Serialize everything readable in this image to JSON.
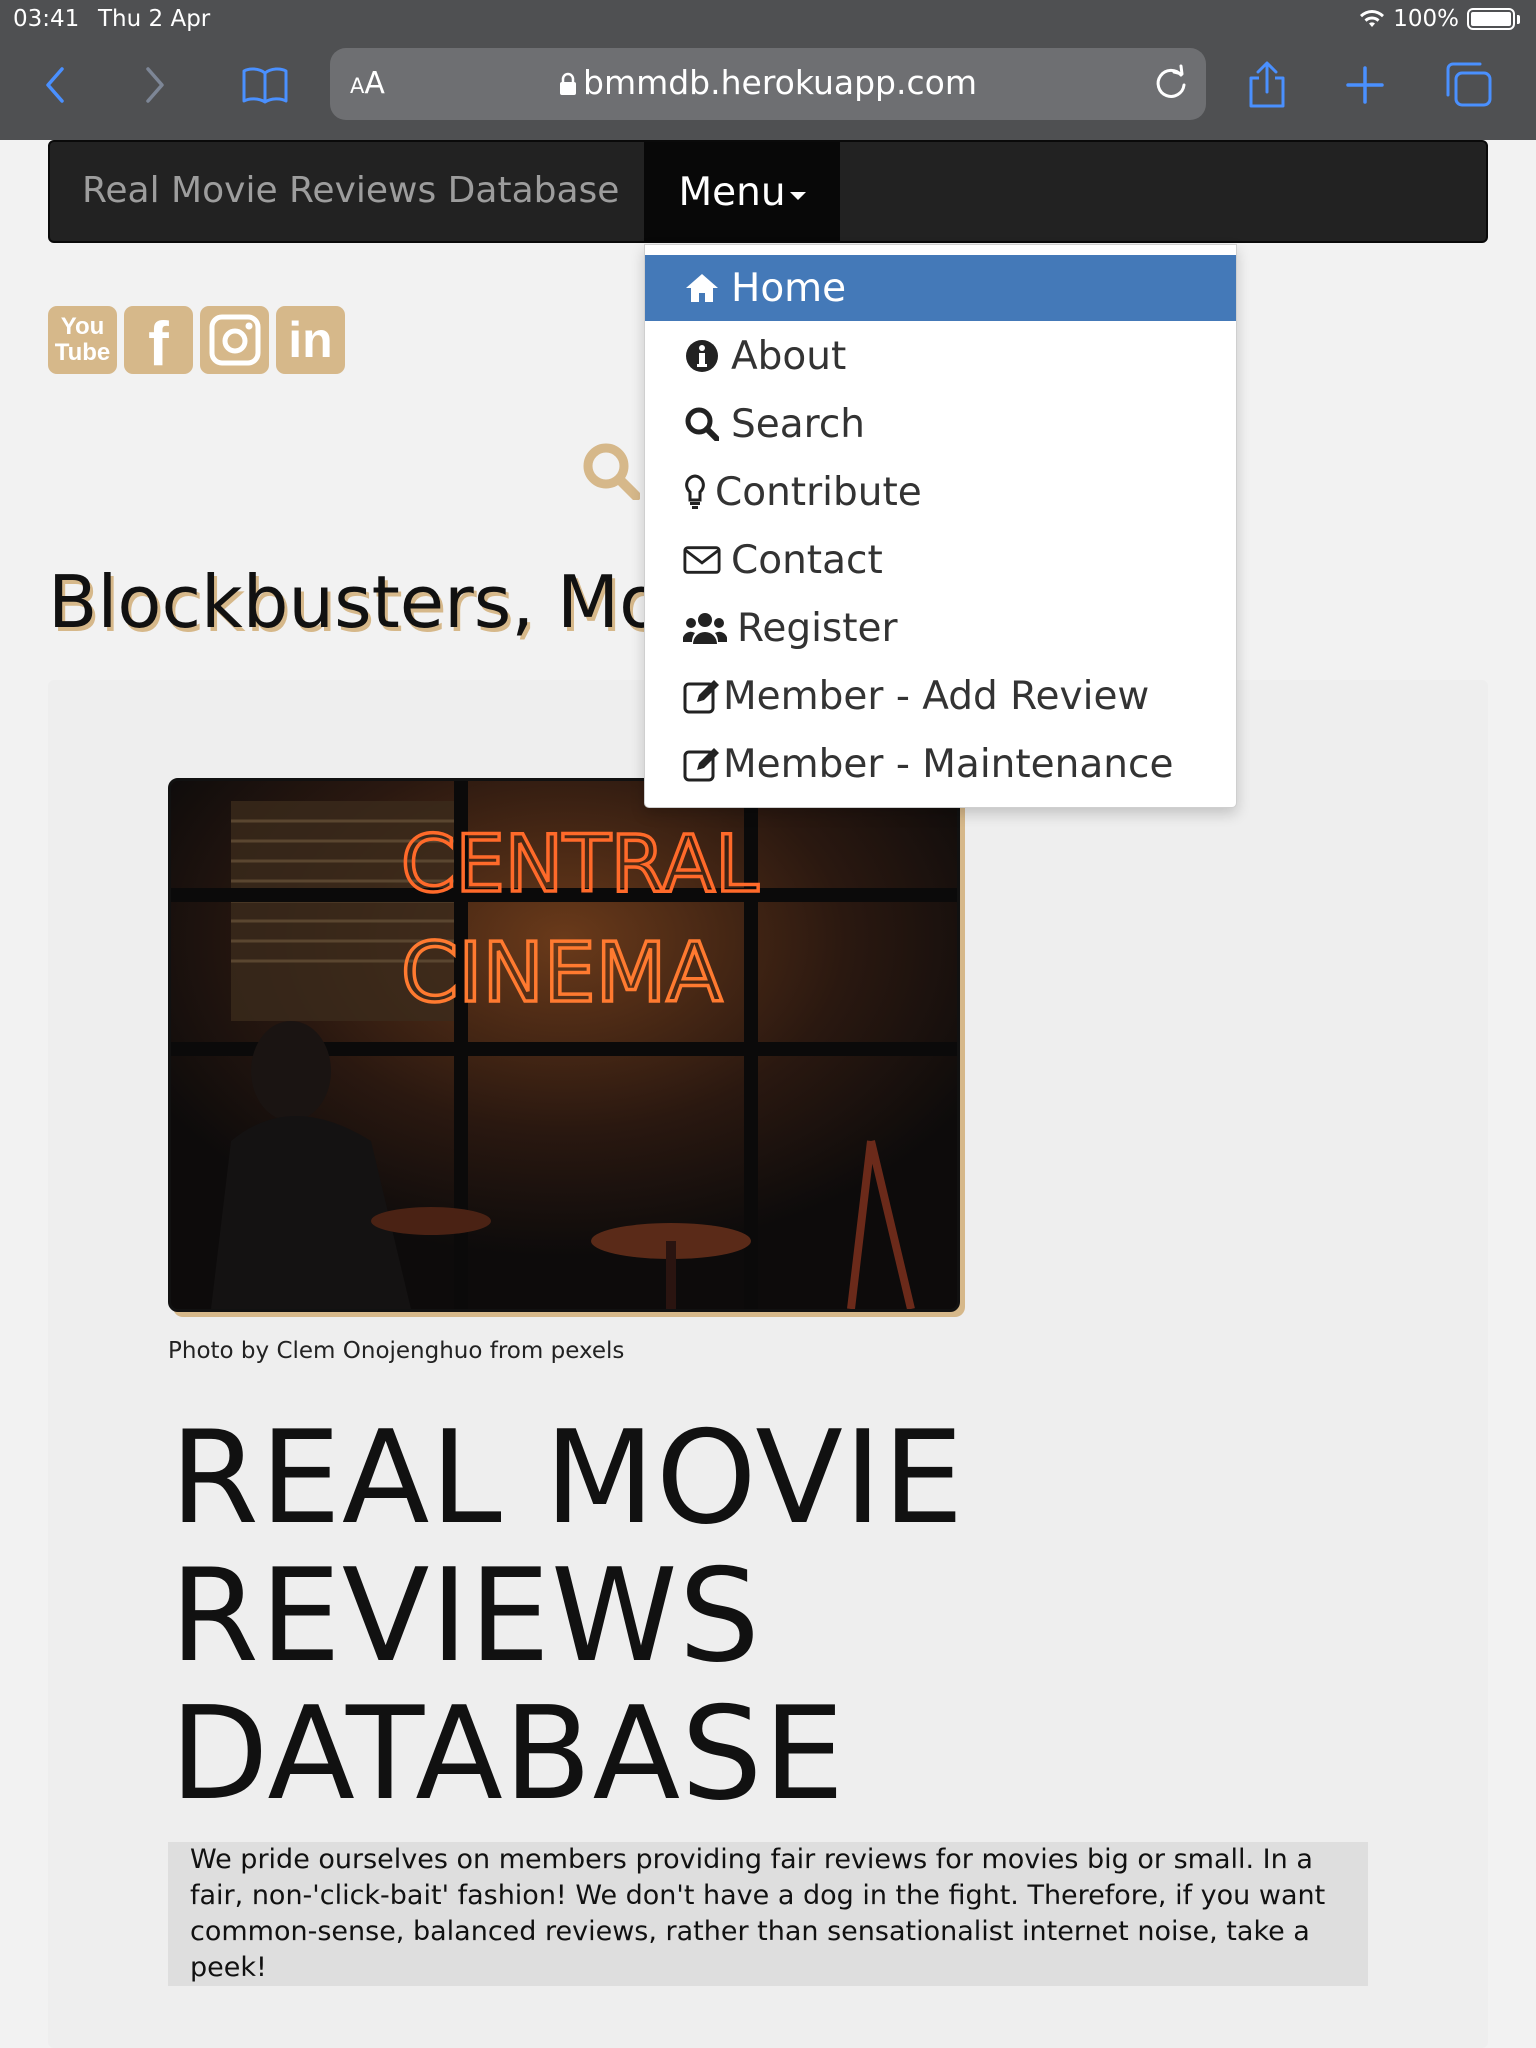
{
  "status_bar": {
    "time": "03:41",
    "date": "Thu 2 Apr",
    "battery": "100%"
  },
  "browser": {
    "text_size_label_small": "A",
    "text_size_label_large": "A",
    "url": "bmmdb.herokuapp.com",
    "icons": [
      "back-icon",
      "forward-icon",
      "bookmarks-icon",
      "lock-icon",
      "reload-icon",
      "share-icon",
      "new-tab-icon",
      "tabs-icon"
    ]
  },
  "navbar": {
    "brand": "Real Movie Reviews Database",
    "menu_label": "Menu"
  },
  "menu": {
    "items": [
      {
        "label": "Home",
        "icon": "home-icon",
        "active": true
      },
      {
        "label": "About",
        "icon": "info-icon",
        "active": false
      },
      {
        "label": "Search",
        "icon": "search-icon",
        "active": false
      },
      {
        "label": "Contribute",
        "icon": "lightbulb-icon",
        "active": false
      },
      {
        "label": "Contact",
        "icon": "envelope-icon",
        "active": false
      },
      {
        "label": "Register",
        "icon": "users-icon",
        "active": false
      },
      {
        "label": "Member - Add Review",
        "icon": "edit-icon",
        "active": false
      },
      {
        "label": "Member - Maintenance",
        "icon": "edit-icon",
        "active": false
      }
    ]
  },
  "socials": [
    {
      "name": "youtube",
      "top": "You",
      "bottom": "Tube"
    },
    {
      "name": "facebook",
      "glyph": "f"
    },
    {
      "name": "instagram"
    },
    {
      "name": "linkedin",
      "glyph": "in"
    }
  ],
  "hero": {
    "tagline": "Blockbusters, Mo",
    "photo_neon_line1": "CENTRAL",
    "photo_neon_line2": "CINEMA",
    "photo_caption": "Photo by Clem Onojenghuo from pexels",
    "title_line1": "REAL MOVIE",
    "title_line2": "REVIEWS",
    "title_line3": "DATABASE",
    "intro_text": "We pride ourselves on members providing fair reviews for movies big or small. In a fair, non-'click-bait' fashion! We don't have a dog in the fight. Therefore, if you want common-sense, balanced reviews, rather than sensationalist internet noise, take a peek!"
  },
  "colors": {
    "accent_tan": "#d6b88a",
    "active_blue": "#4479b8",
    "navbar_bg": "#222222",
    "safari_bar": "#4f5052",
    "ios_blue": "#3b82f6"
  }
}
